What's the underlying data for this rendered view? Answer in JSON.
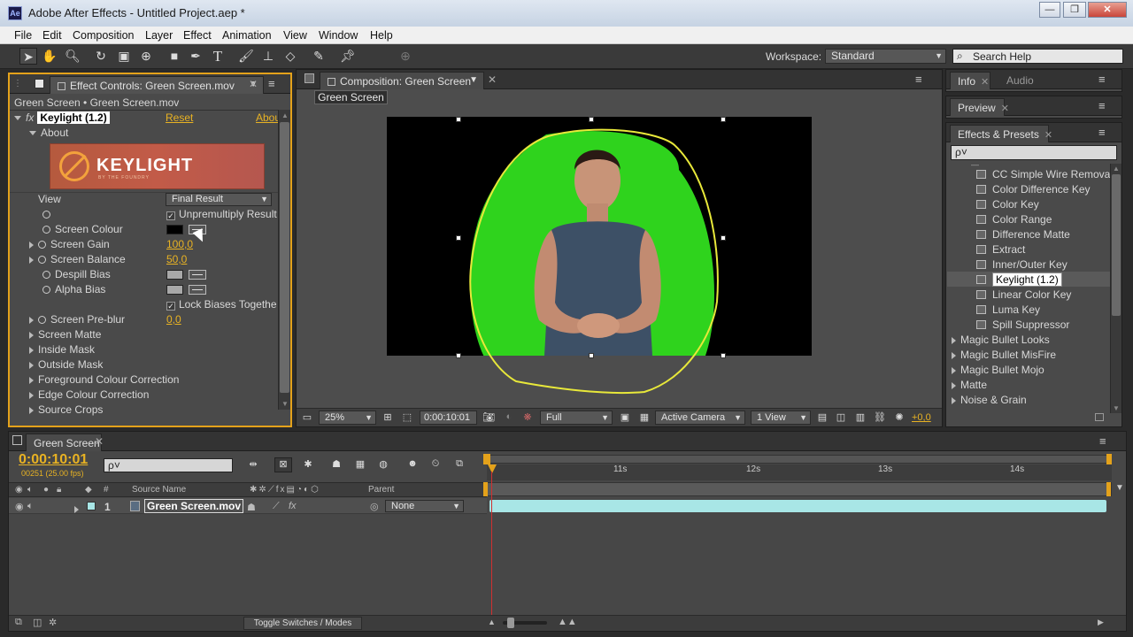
{
  "window": {
    "title": "Adobe After Effects - Untitled Project.aep *",
    "app_icon": "Ae"
  },
  "menu": [
    "File",
    "Edit",
    "Composition",
    "Layer",
    "Effect",
    "Animation",
    "View",
    "Window",
    "Help"
  ],
  "toolbar": {
    "workspace_label": "Workspace:",
    "workspace_value": "Standard",
    "search_placeholder": "Search Help"
  },
  "effect_controls": {
    "tab": "Effect Controls: Green Screen.mov",
    "breadcrumb": "Green Screen • Green Screen.mov",
    "effect_name": "Keylight (1.2)",
    "reset": "Reset",
    "about_link": "Abou",
    "about_group": "About",
    "logo_text": "KEYLIGHT",
    "logo_sub": "BY THE FOUNDRY",
    "view_label": "View",
    "view_value": "Final Result",
    "unpremultiply": "Unpremultiply Result",
    "screen_colour": "Screen Colour",
    "screen_gain": "Screen Gain",
    "screen_gain_value": "100,0",
    "screen_balance": "Screen Balance",
    "screen_balance_value": "50,0",
    "despill_bias": "Despill Bias",
    "alpha_bias": "Alpha Bias",
    "lock_biases": "Lock Biases Togethe",
    "screen_preblur": "Screen Pre-blur",
    "screen_preblur_value": "0,0",
    "groups": [
      "Screen Matte",
      "Inside Mask",
      "Outside Mask",
      "Foreground Colour Correction",
      "Edge Colour Correction",
      "Source Crops"
    ]
  },
  "composition": {
    "tab": "Composition: Green Screen",
    "comp_name": "Green Screen",
    "zoom": "25%",
    "timecode": "0:00:10:01",
    "resolution": "Full",
    "camera": "Active Camera",
    "views": "1 View",
    "exposure": "+0,0"
  },
  "right_panels": {
    "info_tab": "Info",
    "audio_tab": "Audio",
    "preview_tab": "Preview",
    "effects_tab": "Effects & Presets",
    "search_placeholder": "ρ˅",
    "effects": [
      "CC Simple Wire Removal",
      "Color Difference Key",
      "Color Key",
      "Color Range",
      "Difference Matte",
      "Extract",
      "Inner/Outer Key",
      "Keylight (1.2)",
      "Linear Color Key",
      "Luma Key",
      "Spill Suppressor"
    ],
    "selected_effect": "Keylight (1.2)",
    "categories": [
      "Magic Bullet Looks",
      "Magic Bullet MisFire",
      "Magic Bullet Mojo",
      "Matte",
      "Noise & Grain"
    ]
  },
  "timeline": {
    "tab": "Green Screen",
    "timecode": "0:00:10:01",
    "frames": "00251 (25.00 fps)",
    "search_placeholder": "ρ˅",
    "col_num": "#",
    "col_source": "Source Name",
    "col_parent": "Parent",
    "ruler": [
      "11s",
      "12s",
      "13s",
      "14s"
    ],
    "layer": {
      "number": "1",
      "name": "Green Screen.mov",
      "parent": "None"
    },
    "toggle": "Toggle Switches / Modes"
  },
  "colors": {
    "accent": "#e4a21b",
    "green_screen": "#2fd31d",
    "mask": "#e8e83a",
    "layer_bar": "#a8e6e6"
  }
}
